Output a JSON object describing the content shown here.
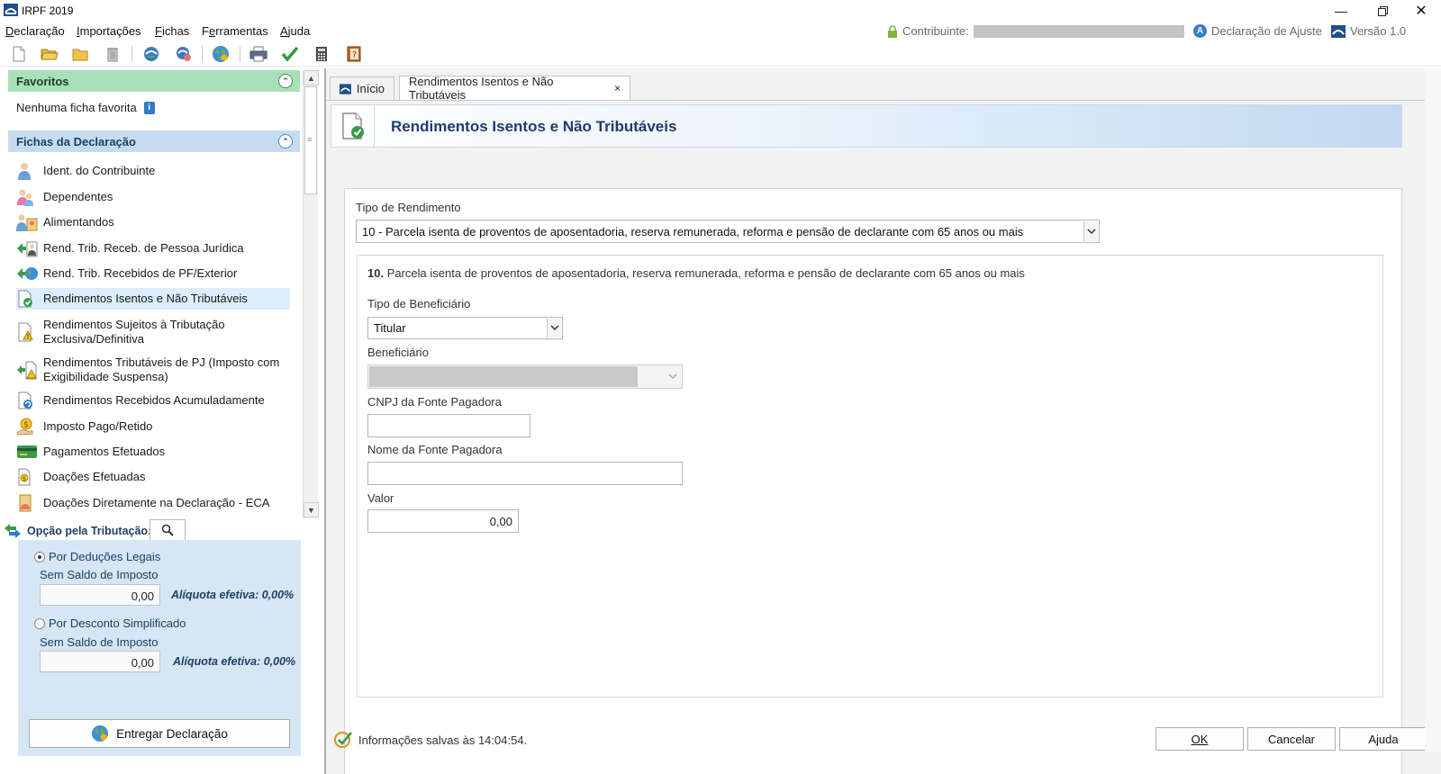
{
  "window": {
    "title": "IRPF 2019"
  },
  "menu": {
    "items": [
      {
        "label": "Declaração",
        "underline": "D",
        "rest": "eclaração"
      },
      {
        "label": "Importações",
        "underline": "I",
        "rest": "mportações"
      },
      {
        "label": "Fichas",
        "underline": "F",
        "rest": "ichas"
      },
      {
        "label": "Ferramentas",
        "underline": "e",
        "pre": "F",
        "rest": "rramentas"
      },
      {
        "label": "Ajuda",
        "underline": "A",
        "rest": "juda"
      }
    ],
    "contribuinte_label": "Contribuinte:",
    "declaracao_label": "Declaração de Ajuste",
    "versao_label": "Versão 1.0"
  },
  "toolbar": {
    "icons": [
      "new-document-icon",
      "open-folder-icon",
      "folder-icon",
      "trash-icon",
      "import-icon",
      "recover-icon",
      "globe-icon",
      "print-icon",
      "checkmark-icon",
      "calculator-icon",
      "help-book-icon"
    ]
  },
  "sidebar": {
    "favoritos": {
      "title": "Favoritos",
      "empty_text": "Nenhuma ficha favorita"
    },
    "fichas": {
      "title": "Fichas da Declaração",
      "items": [
        {
          "label": "Ident. do Contribuinte",
          "icon": "person-icon"
        },
        {
          "label": "Dependentes",
          "icon": "dependents-icon"
        },
        {
          "label": "Alimentandos",
          "icon": "alimentandos-icon"
        },
        {
          "label": "Rend. Trib. Receb. de Pessoa Jurídica",
          "icon": "income-pj-icon"
        },
        {
          "label": "Rend. Trib. Recebidos de PF/Exterior",
          "icon": "income-pf-icon"
        },
        {
          "label": "Rendimentos Isentos e Não Tributáveis",
          "icon": "exempt-income-icon"
        },
        {
          "label1": "Rendimentos Sujeitos à Tributação",
          "label2": "Exclusiva/Definitiva",
          "icon": "exclusive-tax-icon"
        },
        {
          "label1": "Rendimentos Tributáveis de PJ (Imposto com",
          "label2": "Exigibilidade Suspensa)",
          "icon": "suspended-tax-icon"
        },
        {
          "label": "Rendimentos Recebidos Acumuladamente",
          "icon": "accumulated-income-icon"
        },
        {
          "label": "Imposto Pago/Retido",
          "icon": "tax-paid-icon"
        },
        {
          "label": "Pagamentos Efetuados",
          "icon": "payments-icon"
        },
        {
          "label": "Doações Efetuadas",
          "icon": "donations-icon"
        },
        {
          "label": "Doações Diretamente na Declaração - ECA",
          "icon": "eca-donations-icon"
        }
      ]
    },
    "opcao": {
      "title": "Opção pela Tributação:",
      "deducoes": {
        "label": "Por Deduções Legais",
        "saldo": "Sem Saldo de Imposto",
        "value": "0,00",
        "aliquota": "Alíquota efetiva: 0,00%",
        "selected": true
      },
      "simplificado": {
        "label": "Por Desconto Simplificado",
        "saldo": "Sem Saldo de Imposto",
        "value": "0,00",
        "aliquota": "Alíquota efetiva: 0,00%",
        "selected": false
      }
    },
    "entregar_label": "Entregar Declaração"
  },
  "tabs": [
    {
      "label": "Início",
      "active": false
    },
    {
      "label": "Rendimentos Isentos e Não Tributáveis",
      "active": true,
      "close": "×"
    }
  ],
  "page": {
    "title": "Rendimentos Isentos e Não Tributáveis",
    "tipo_rendimento_label": "Tipo de Rendimento",
    "tipo_rendimento_value": "10 - Parcela isenta de proventos de aposentadoria, reserva remunerada, reforma e pensão de declarante com 65 anos ou mais",
    "section_number": "10.",
    "section_text": "Parcela isenta de proventos de aposentadoria, reserva remunerada, reforma e pensão de declarante com 65 anos ou mais",
    "tipo_beneficiario_label": "Tipo de Beneficiário",
    "tipo_beneficiario_value": "Titular",
    "beneficiario_label": "Beneficiário",
    "cnpj_label": "CNPJ da Fonte Pagadora",
    "cnpj_value": "",
    "nome_label": "Nome da Fonte Pagadora",
    "nome_value": "",
    "valor_label": "Valor",
    "valor_value": "0,00"
  },
  "status": {
    "text": "Informações salvas às 14:04:54."
  },
  "buttons": {
    "ok": "OK",
    "cancelar": "Cancelar",
    "ajuda": "Ajuda"
  },
  "colors": {
    "favoritos_header": "#a8e0b8",
    "fichas_header": "#c5dcf0",
    "title_blue": "#1f3c6b",
    "selected_item": "#dceefb"
  }
}
